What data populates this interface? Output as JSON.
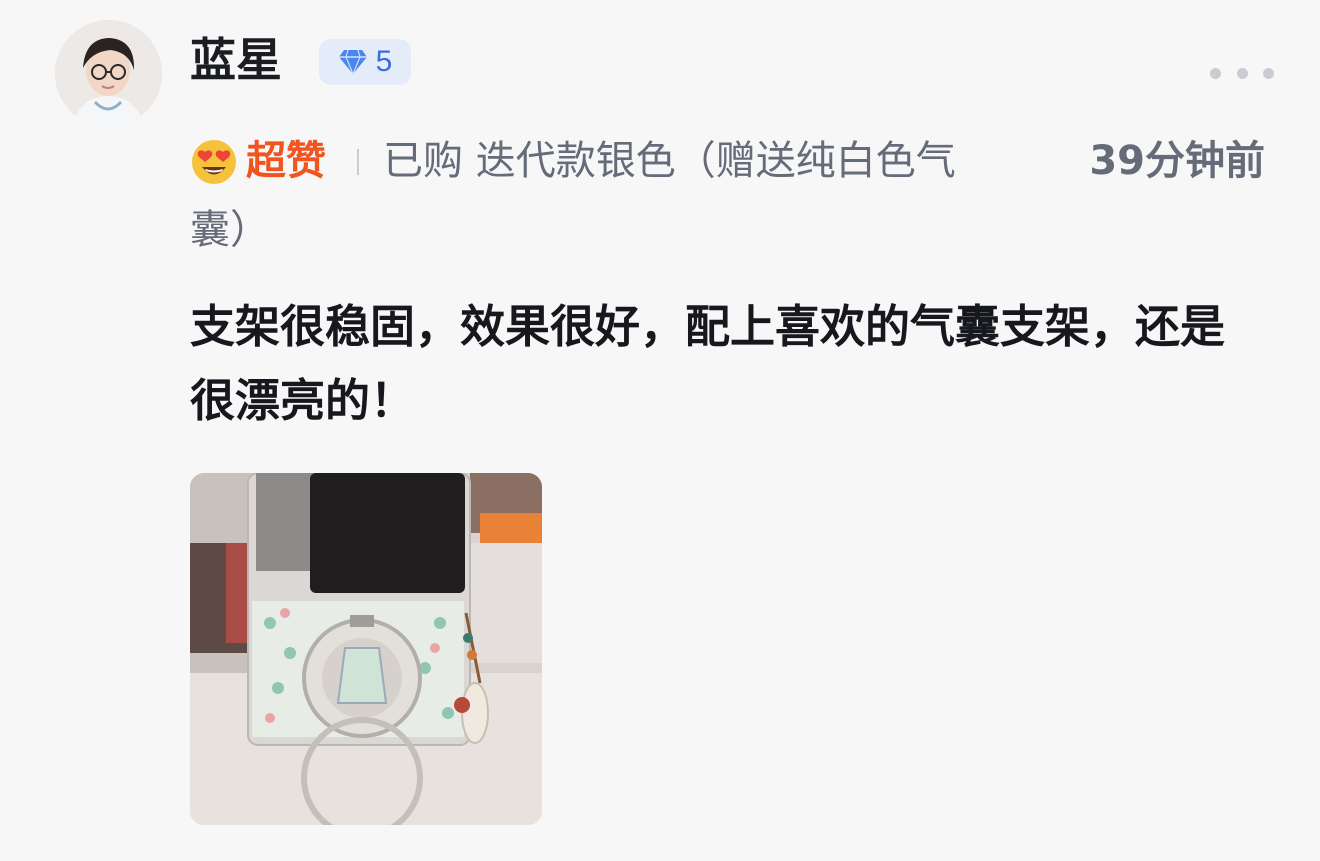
{
  "user": {
    "name": "蓝星",
    "level": "5",
    "level_icon": "diamond-icon"
  },
  "rating": {
    "emoji": "heart-eyes-icon",
    "label": "超赞"
  },
  "purchase": {
    "line1": "已购 迭代款银色（赠送纯白色气",
    "line2": "囊）"
  },
  "timestamp": "39分钟前",
  "review": {
    "text": "支架很稳固，效果很好，配上喜欢的气囊支架，还是很漂亮的！"
  },
  "colors": {
    "accent_rating": "#f1541f",
    "level_blue": "#3a6fd8",
    "text_secondary": "#656b78"
  }
}
